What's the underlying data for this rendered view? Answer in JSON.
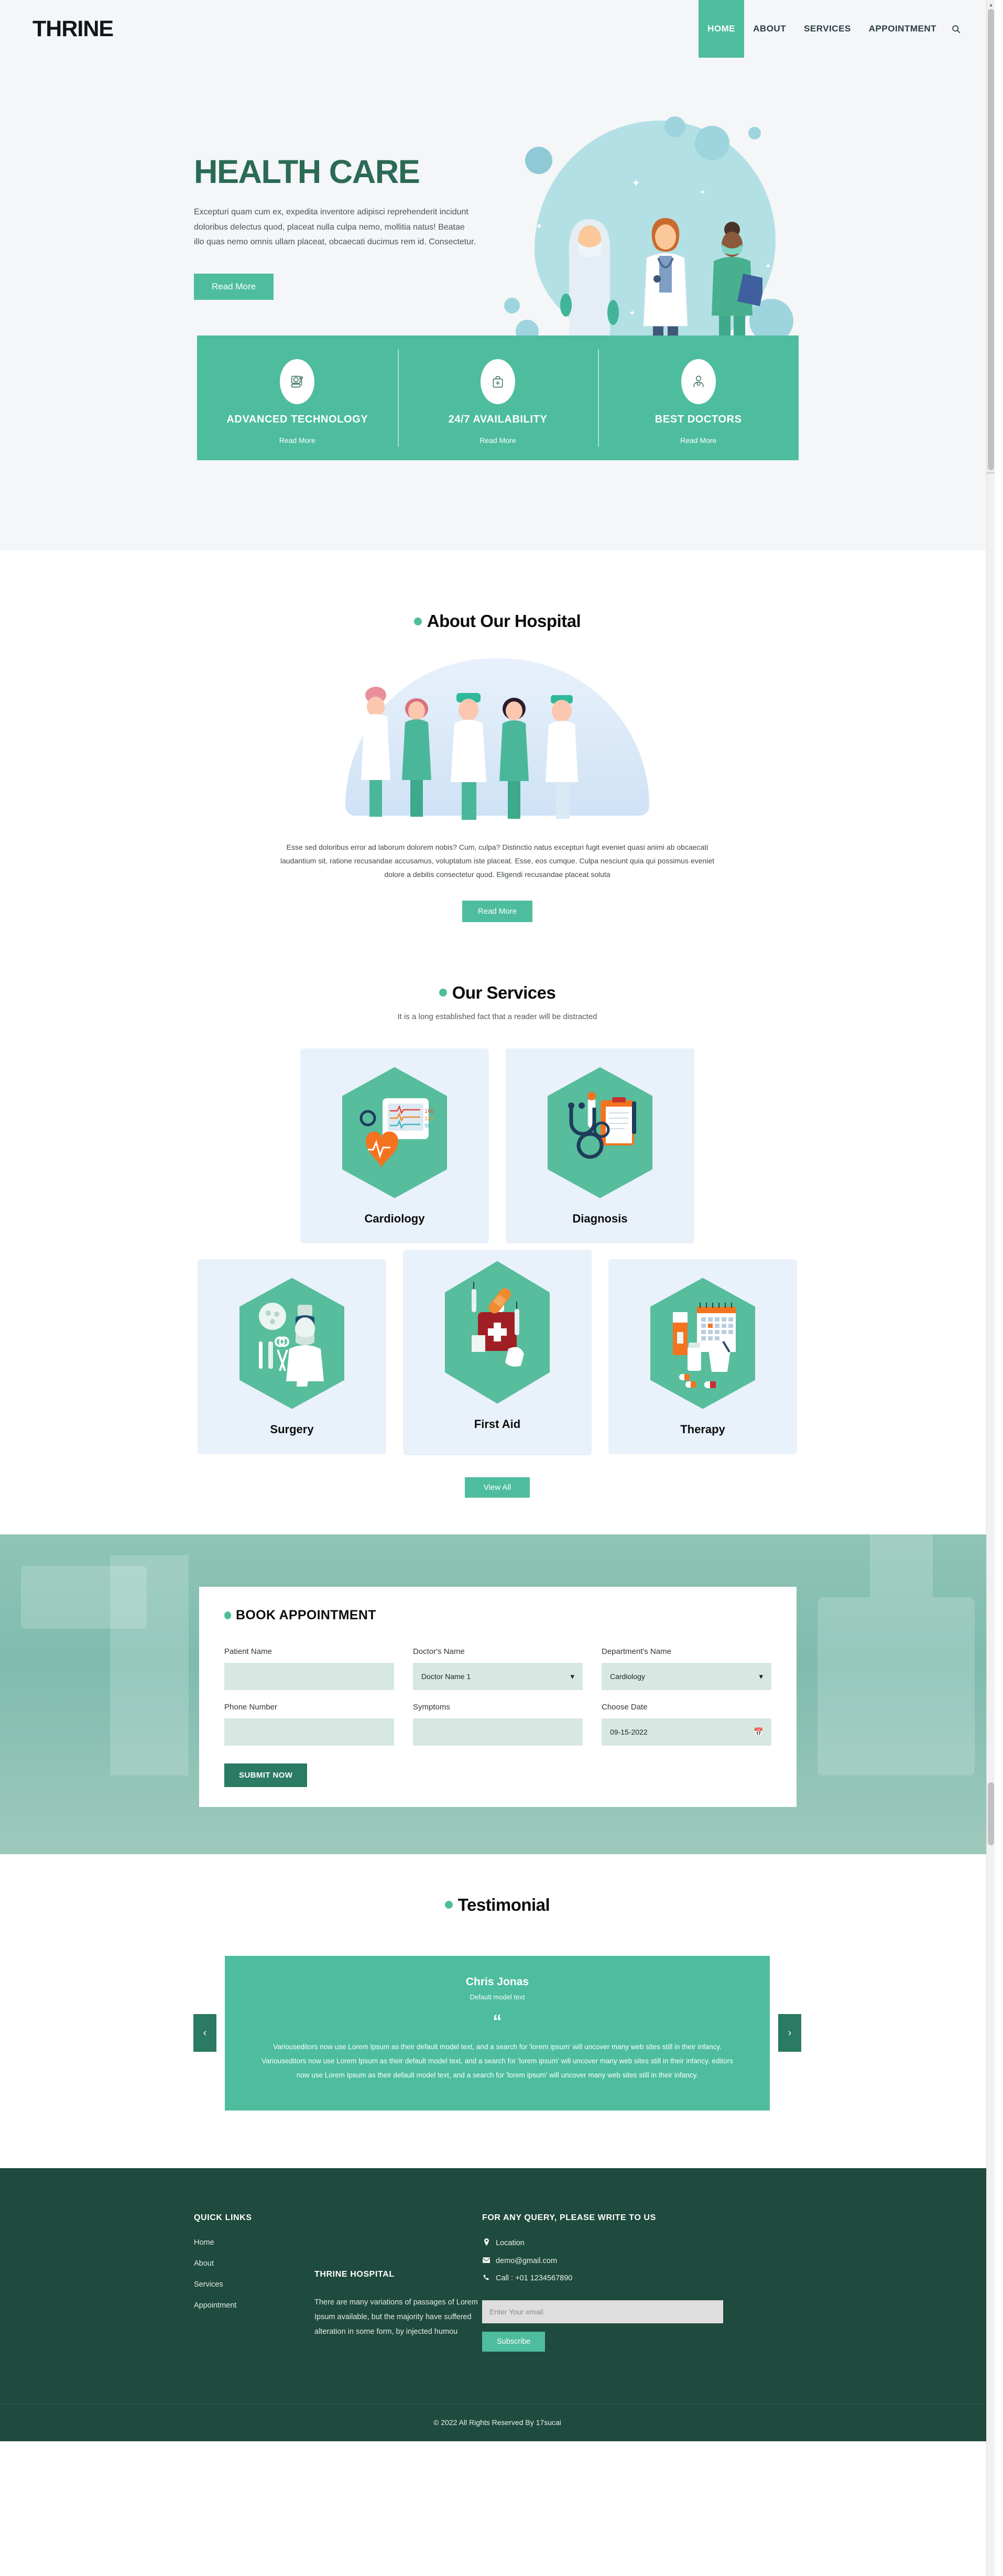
{
  "header": {
    "logo": "THRINE",
    "nav": [
      {
        "label": "HOME",
        "active": true
      },
      {
        "label": "ABOUT",
        "active": false
      },
      {
        "label": "SERVICES",
        "active": false
      },
      {
        "label": "APPOINTMENT",
        "active": false
      }
    ],
    "search_icon": "search-icon"
  },
  "hero": {
    "title": "HEALTH CARE",
    "description": "Excepturi quam cum ex, expedita inventore adipisci reprehenderit incidunt doloribus delectus quod, placeat nulla culpa nemo, mollitia natus! Beatae illo quas nemo omnis ullam placeat, obcaecati ducimus rem id. Consectetur.",
    "cta": "Read More",
    "carousel": {
      "total": 3,
      "active_index": 2
    }
  },
  "features": [
    {
      "title": "ADVANCED TECHNOLOGY",
      "link": "Read More",
      "icon": "monitor-icon"
    },
    {
      "title": "24/7 AVAILABILITY",
      "link": "Read More",
      "icon": "medical-kit-icon"
    },
    {
      "title": "BEST DOCTORS",
      "link": "Read More",
      "icon": "doctor-icon"
    }
  ],
  "about": {
    "title": "About Our Hospital",
    "body": "Esse sed doloribus error ad laborum dolorem nobis? Cum, culpa? Distinctio natus excepturi fugit eveniet quasi animi ab obcaecati laudantium sit, ratione recusandae accusamus, voluptatum iste placeat. Esse, eos cumque. Culpa nesciunt quia qui possimus eveniet dolore a debitis consectetur quod. Eligendi recusandae placeat soluta",
    "cta": "Read More"
  },
  "services": {
    "title": "Our Services",
    "subtitle": "It is a long established fact that a reader will be distracted",
    "cta": "View All",
    "row1": [
      {
        "label": "Cardiology",
        "icon": "heart-monitor-icon"
      },
      {
        "label": "Diagnosis",
        "icon": "stethoscope-clipboard-icon"
      }
    ],
    "row2": [
      {
        "label": "Surgery",
        "icon": "surgeon-tools-icon"
      },
      {
        "label": "First Aid",
        "icon": "first-aid-kit-icon"
      },
      {
        "label": "Therapy",
        "icon": "medicine-calendar-icon"
      }
    ]
  },
  "appointment": {
    "title": "BOOK APPOINTMENT",
    "fields": {
      "patient_name": {
        "label": "Patient Name",
        "value": "",
        "placeholder": ""
      },
      "doctor_name": {
        "label": "Doctor's Name",
        "value": "Doctor Name 1"
      },
      "department_name": {
        "label": "Department's Name",
        "value": "Cardiology"
      },
      "phone_number": {
        "label": "Phone Number",
        "value": "",
        "placeholder": ""
      },
      "symptoms": {
        "label": "Symptoms",
        "value": "",
        "placeholder": ""
      },
      "choose_date": {
        "label": "Choose Date",
        "value": "09-15-2022",
        "icon": "calendar-icon"
      }
    },
    "submit": "SUBMIT NOW"
  },
  "testimonial": {
    "title": "Testimonial",
    "name": "Chris Jonas",
    "role": "Default model text",
    "quote_mark": "“",
    "body": "Variouseditors now use Lorem Ipsum as their default model text, and a search for 'lorem ipsum' will uncover many web sites still in their infancy. Variouseditors now use Lorem Ipsum as their default model text, and a search for 'lorem ipsum' will uncover many web sites still in their infancy. editors now use Lorem Ipsum as their default model text, and a search for 'lorem ipsum' will uncover many web sites still in their infancy.",
    "prev": "‹",
    "next": "›"
  },
  "footer": {
    "quick_links_title": "QUICK LINKS",
    "quick_links": [
      "Home",
      "About",
      "Services",
      "Appointment"
    ],
    "hospital_title": "THRINE HOSPITAL",
    "hospital_text": "There are many variations of passages of Lorem Ipsum available, but the majority have suffered alteration in some form, by injected humou",
    "query_title": "FOR ANY QUERY, PLEASE WRITE TO US",
    "contacts": [
      {
        "icon": "location-pin-icon",
        "glyph": "⌘",
        "text": "Location"
      },
      {
        "icon": "envelope-icon",
        "glyph": "✉",
        "text": "demo@gmail.com"
      },
      {
        "icon": "phone-icon",
        "glyph": "☎",
        "text": "Call : +01 1234567890"
      }
    ],
    "email_placeholder": "Enter Your email",
    "email_value": "",
    "subscribe": "Subscribe",
    "copyright": "© 2022 All Rights Reserved By 17sucai"
  },
  "colors": {
    "teal": "#4dbd9e",
    "dark_green": "#2b7a63",
    "footer_green": "#1f4a3e",
    "hero_bg": "#f4f6f8",
    "card_blue": "#e9f1fa"
  }
}
